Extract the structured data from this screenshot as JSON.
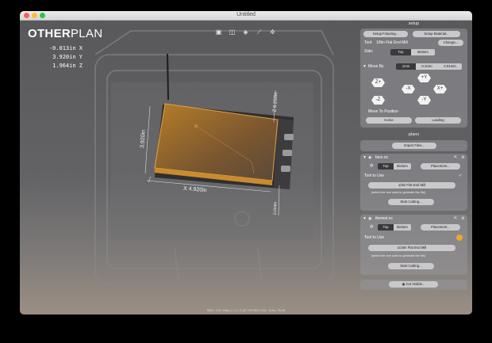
{
  "window": {
    "title": "Untitled"
  },
  "logo": {
    "part1": "OTHER",
    "part2": "PLAN"
  },
  "coords": {
    "x": "-0.013in X",
    "y": "3.920in Y",
    "z": "1.964in Z"
  },
  "viewport": {
    "dim_x": "X 4.920in",
    "dim_y": "3.920in",
    "dim_z": "Z 0.253in",
    "dim_right": "0.004in"
  },
  "status": "Shift / Ctrl / Mac (↑↓↑) / Z (57 X0.053.0.00) · Area: 76.46",
  "setup": {
    "header": "setup",
    "fixturing_button": "Setup Fixturing...",
    "material_button": "Setup Material...",
    "tool_label": "Tool:",
    "tool_value": "1/8in Flat End Mill",
    "change_button": "Change...",
    "side_label": "Side:",
    "side_top": "Top",
    "side_bottom": "Bottom",
    "move_by_label": "Move By",
    "move_options": [
      "1mm",
      "0.1mm",
      "0.01mm"
    ],
    "jog": {
      "zplus": "Z+",
      "yplus": "+Y",
      "xminus": "-X",
      "xplus": "X+",
      "zminus": "-Z",
      "yminus": "-Y"
    },
    "move_to_position": "Move To Position",
    "home_button": "Home",
    "loading_button": "Loading"
  },
  "plans": {
    "header": "plans",
    "import_button": "Import Files...",
    "items": [
      {
        "name": "face.nc",
        "side_top": "Top",
        "side_bottom": "Bottom",
        "placement_button": "Placement...",
        "tool_to_use": "Tool to Use",
        "tool_value": "1/8in Flat End Mill",
        "hint": "(select the one used to generate the file)",
        "start_button": "Start Cutting..."
      },
      {
        "name": "thereol.nc",
        "side_top": "Top",
        "side_bottom": "Bottom",
        "placement_button": "Placement...",
        "tool_to_use": "Tool to Use",
        "tool_value": "1/16in Flat End Mill",
        "hint": "(select the one used to generate the file)",
        "start_button": "Start Cutting..."
      }
    ],
    "cut_visible_button": "Cut Visible..."
  },
  "colors": {
    "accent": "#e8a23a",
    "warning": "#f2a52d",
    "panel": "#8e8e92"
  }
}
